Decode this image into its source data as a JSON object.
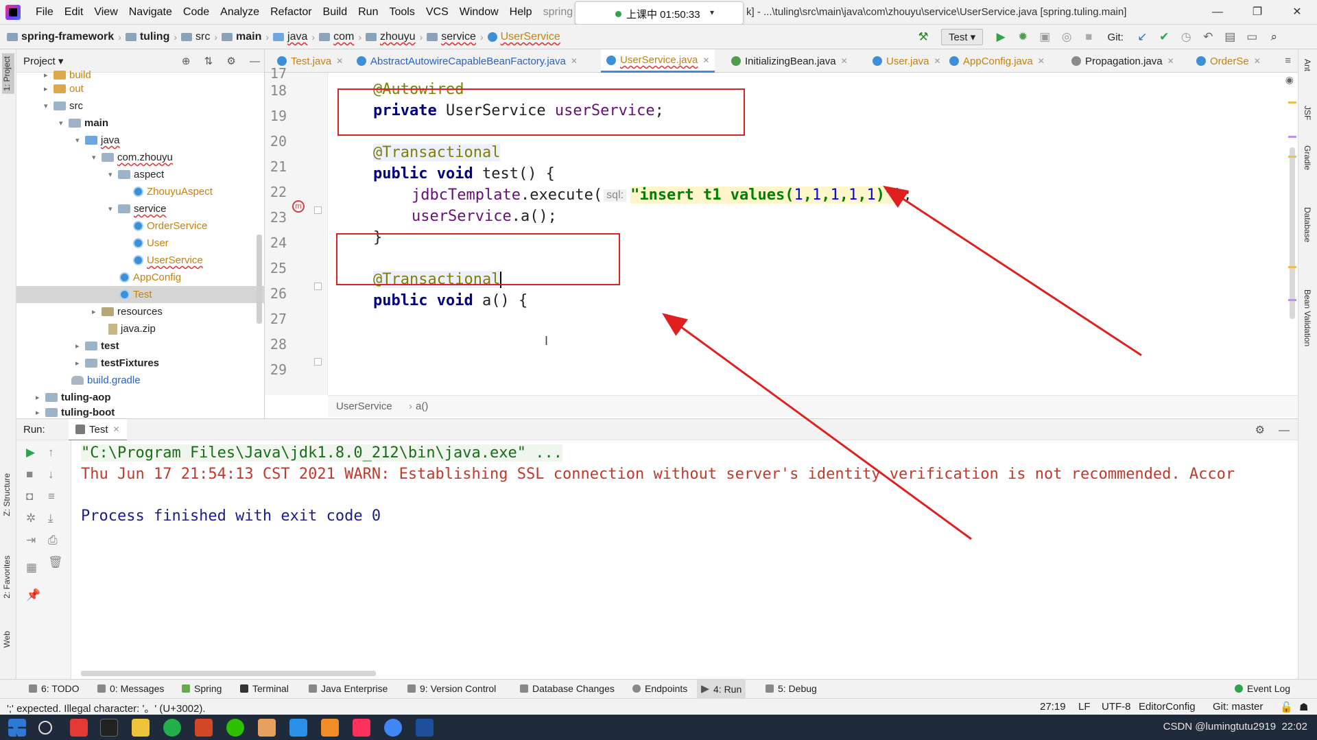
{
  "menubar": {
    "items": [
      "File",
      "Edit",
      "View",
      "Navigate",
      "Code",
      "Analyze",
      "Refactor",
      "Build",
      "Run",
      "Tools",
      "VCS",
      "Window",
      "Help"
    ],
    "project_fragment": "spring",
    "clock": "上课中 01:50:33",
    "window_title": "k] - ...\\tuling\\src\\main\\java\\com\\zhouyu\\service\\UserService.java [spring.tuling.main]",
    "controls": [
      "—",
      "❐",
      "✕"
    ]
  },
  "navbar": {
    "breadcrumbs": [
      "spring-framework",
      "tuling",
      "src",
      "main",
      "java",
      "com",
      "zhouyu",
      "service",
      "UserService"
    ],
    "run_config": "Test",
    "git_label": "Git:"
  },
  "left_strip": {
    "project": "1: Project",
    "structure": "Z: Structure",
    "favorites": "2: Favorites",
    "web": "Web"
  },
  "project_panel": {
    "title": "Project",
    "tree": [
      {
        "label": "build",
        "kind": "folder-orange"
      },
      {
        "label": "out",
        "kind": "folder-orange"
      },
      {
        "label": "src",
        "kind": "folder"
      },
      {
        "label": "main",
        "kind": "folder-src"
      },
      {
        "label": "java",
        "kind": "folder-src"
      },
      {
        "label": "com.zhouyu",
        "kind": "package"
      },
      {
        "label": "aspect",
        "kind": "package"
      },
      {
        "label": "ZhouyuAspect",
        "kind": "class"
      },
      {
        "label": "service",
        "kind": "package"
      },
      {
        "label": "OrderService",
        "kind": "class"
      },
      {
        "label": "User",
        "kind": "class"
      },
      {
        "label": "UserService",
        "kind": "class"
      },
      {
        "label": "AppConfig",
        "kind": "class"
      },
      {
        "label": "Test",
        "kind": "class"
      },
      {
        "label": "resources",
        "kind": "folder-res"
      },
      {
        "label": "java.zip",
        "kind": "zip"
      },
      {
        "label": "test",
        "kind": "folder"
      },
      {
        "label": "testFixtures",
        "kind": "folder"
      },
      {
        "label": "build.gradle",
        "kind": "gradle"
      },
      {
        "label": "tuling-aop",
        "kind": "module"
      },
      {
        "label": "tuling-boot",
        "kind": "module"
      }
    ]
  },
  "tabs": [
    {
      "label": "Test.java"
    },
    {
      "label": "AbstractAutowireCapableBeanFactory.java"
    },
    {
      "label": "UserService.java",
      "active": true
    },
    {
      "label": "InitializingBean.java"
    },
    {
      "label": "User.java"
    },
    {
      "label": "AppConfig.java"
    },
    {
      "label": "Propagation.java"
    },
    {
      "label": "OrderSe"
    }
  ],
  "editor": {
    "line_numbers": [
      "17",
      "18",
      "19",
      "20",
      "21",
      "22",
      "23",
      "24",
      "25",
      "26",
      "27",
      "28",
      "29"
    ],
    "code": {
      "l18_anno": "@Autowired",
      "l19_kw": "private",
      "l19_type": " UserService ",
      "l19_field": "userService",
      "l19_end": ";",
      "l21_anno": "@Transactional",
      "l22_kw1": "public",
      "l22_kw2": "void",
      "l22_rest": " test() {",
      "l23_field": "jdbcTemplate",
      "l23_call": ".execute(",
      "l23_hint": "sql:",
      "l23_str1": "\"insert t1 values(",
      "l23_n1": "1",
      "l23_c": ",",
      "l23_str2": ")\"",
      "l23_end": ");",
      "l24_field": "userService",
      "l24_rest": ".a();",
      "l25": "}",
      "l27_anno": "@Transactional",
      "l28_kw1": "public",
      "l28_kw2": "void",
      "l28_rest": " a() {"
    },
    "breadcrumb": [
      "UserService",
      "a()"
    ]
  },
  "right_strip": [
    "Ant",
    "JSF",
    "Gradle",
    "Database",
    "Bean Validation"
  ],
  "run_panel": {
    "label": "Run:",
    "tab": "Test",
    "lines": {
      "cmd": "\"C:\\Program Files\\Java\\jdk1.8.0_212\\bin\\java.exe\" ...",
      "warn": "Thu Jun 17 21:54:13 CST 2021 WARN: Establishing SSL connection without server's identity verification is not recommended. Accor",
      "exit": "Process finished with exit code 0"
    }
  },
  "bottom_tools": [
    "6: TODO",
    "0: Messages",
    "Spring",
    "Terminal",
    "Java Enterprise",
    "9: Version Control",
    "Database Changes",
    "Endpoints",
    "4: Run",
    "5: Debug",
    "Event Log"
  ],
  "status": {
    "message": "';' expected. Illegal character: '。' (U+3002).",
    "position": "27:19",
    "line_sep": "LF",
    "encoding": "UTF-8",
    "editorconfig": "EditorConfig",
    "git": "Git: master"
  },
  "taskbar": {
    "tray_text": "CSDN @lumingtutu2919",
    "time": "22:02"
  },
  "colors": {
    "annotation_red": "#e02020",
    "accent_blue": "#4a86d8"
  }
}
